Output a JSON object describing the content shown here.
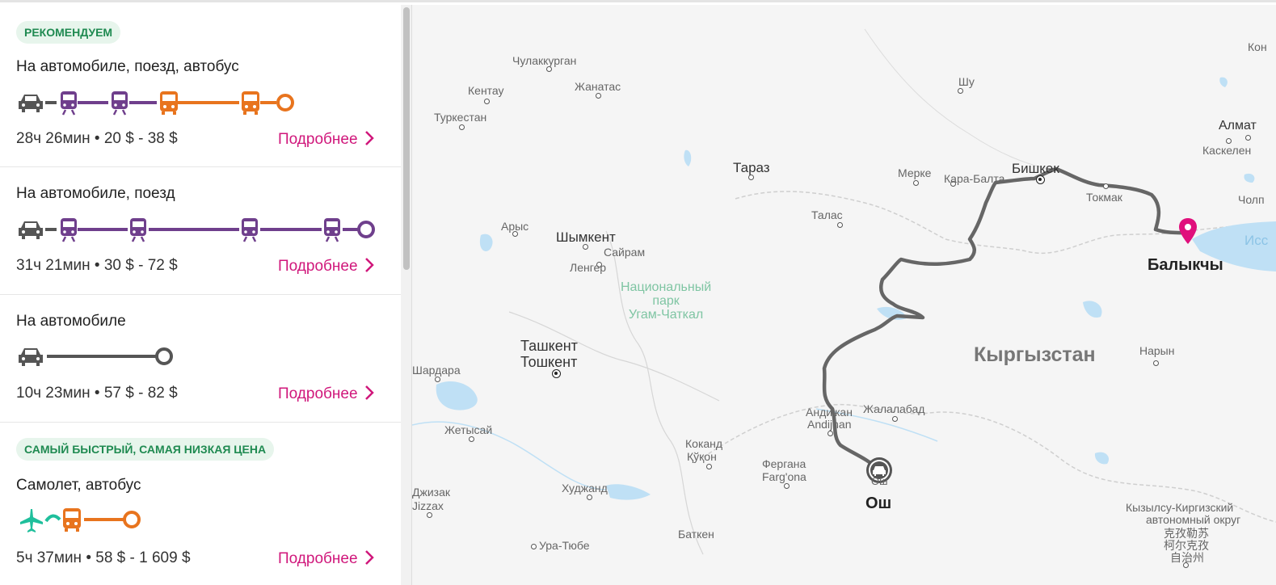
{
  "routes": [
    {
      "badge": "РЕКОМЕНДУЕМ",
      "title": "На автомобиле, поезд, автобус",
      "meta": "28ч 26мин • 20 $ - 38 $",
      "details_label": "Подробнее",
      "segments": [
        "car",
        "train",
        "train",
        "bus",
        "bus"
      ]
    },
    {
      "badge": "",
      "title": "На автомобиле, поезд",
      "meta": "31ч 21мин • 30 $ - 72 $",
      "details_label": "Подробнее",
      "segments": [
        "car",
        "train",
        "train",
        "train",
        "train"
      ]
    },
    {
      "badge": "",
      "title": "На автомобиле",
      "meta": "10ч 23мин • 57 $ - 82 $",
      "details_label": "Подробнее",
      "segments": [
        "car"
      ]
    },
    {
      "badge": "САМЫЙ БЫСТРЫЙ, САМАЯ НИЗКАЯ ЦЕНА",
      "title": "Самолет, автобус",
      "meta": "5ч 37мин • 58 $ - 1 609 $",
      "details_label": "Подробнее",
      "segments": [
        "plane",
        "bus"
      ]
    }
  ],
  "colors": {
    "car": "#555555",
    "train": "#6f3f8c",
    "bus": "#e8741e",
    "plane": "#1fbf9c",
    "accent": "#d0177b",
    "route_line": "#666666",
    "water": "#bfe0f5"
  },
  "map": {
    "country": "Кыргызстан",
    "origin": "Ош",
    "origin_sub": "Ош",
    "destination": "Балыкчы",
    "park": [
      "Национальный",
      "парк",
      "Угам-Чаткал"
    ],
    "cities": {
      "chulakkurgan": "Чулаккурган",
      "kentau": "Кентау",
      "zhanatas": "Жанатас",
      "turkestan": "Туркестан",
      "shu": "Шу",
      "almaty": "Алмат",
      "kaskelen": "Каскелен",
      "kon": "Кон",
      "taraz": "Тараз",
      "merke": "Мерке",
      "karabalta": "Кара-Балта",
      "bishkek": "Бишкек",
      "tokmak": "Токмак",
      "cholp": "Чолп",
      "iss": "Исс",
      "talas": "Талас",
      "arys": "Арыс",
      "shymkent": "Шымкент",
      "sairam": "Сайрам",
      "lenger": "Ленгер",
      "tashkent": "Ташкент",
      "toshkent": "Тошкент",
      "shardara": "Шардара",
      "naryn": "Нарын",
      "andijan1": "Андижан",
      "andijan2": "Andijhan",
      "jalalabad": "Жалалабад",
      "zhetysai": "Жетысай",
      "kokand1": "Коканд",
      "kokand2": "Қўқон",
      "fergana1": "Фергана",
      "fergana2": "Farg'ona",
      "khujand": "Худжанд",
      "jizzakh1": "Джизак",
      "jizzakh2": "Jizzax",
      "batken": "Баткен",
      "uratyube": "Ура-Тюбе",
      "kizilsu1": "Кызылсу-Киргизский",
      "kizilsu2": "автономный округ",
      "kizilsu3": "克孜勒苏",
      "kizilsu4": "柯尔克孜",
      "kizilsu5": "自治州"
    }
  }
}
